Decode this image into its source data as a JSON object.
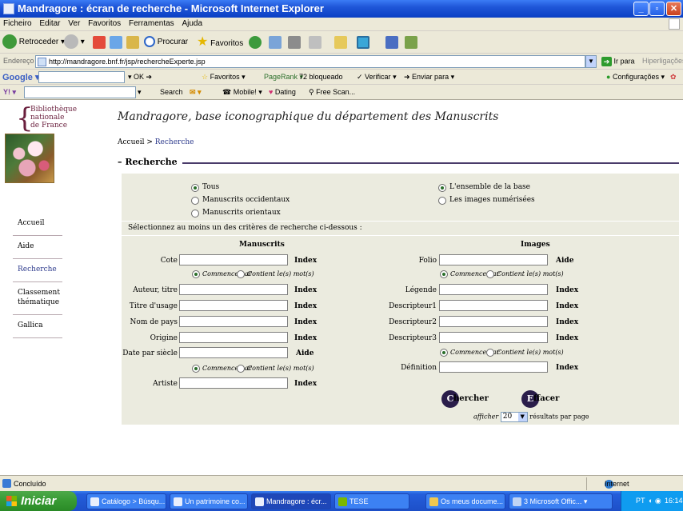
{
  "window": {
    "title": "Mandragore : écran de recherche - Microsoft Internet Explorer"
  },
  "menu": [
    "Ficheiro",
    "Editar",
    "Ver",
    "Favoritos",
    "Ferramentas",
    "Ajuda"
  ],
  "toolbar": {
    "back": "Retroceder",
    "search": "Procurar",
    "favorites": "Favoritos"
  },
  "address": {
    "label": "Endereço",
    "url": "http://mandragore.bnf.fr/jsp/rechercheExperte.jsp",
    "go": "Ir para",
    "links": "Hiperligações"
  },
  "googlebar": {
    "logo": "Google",
    "ok": "OK",
    "favoritos": "Favoritos",
    "pagerank": "PageRank",
    "blocked": "72 bloqueado",
    "verificar": "Verificar",
    "enviar": "Enviar para",
    "config": "Configurações"
  },
  "ybar": {
    "search": "Search",
    "mobile": "Mobile!",
    "dating": "Dating",
    "freescan": "Free Scan..."
  },
  "page": {
    "logo_lines": [
      "Bibliothèque",
      "nationale",
      "de France"
    ],
    "site_title": "Mandragore, base iconographique du département des Manuscrits",
    "crumb_home": "Accueil",
    "crumb_sep": ">",
    "crumb_current": "Recherche",
    "section": "Recherche",
    "nav": [
      "Accueil",
      "Aide",
      "Recherche",
      "Classement thématique",
      "Gallica"
    ],
    "scope": {
      "tous": "Tous",
      "occidentaux": "Manuscrits occidentaux",
      "orientaux": "Manuscrits orientaux",
      "ensemble": "L'ensemble de la base",
      "numerisees": "Les images numérisées"
    },
    "instruction": "Sélectionnez au moins un des critères de recherche ci-dessous :",
    "manuscrits_head": "Manuscrits",
    "images_head": "Images",
    "manuscrits": {
      "cote": "Cote",
      "auteur": "Auteur, titre",
      "titre_usage": "Titre d'usage",
      "nom_pays": "Nom de pays",
      "origine": "Origine",
      "date_siecle": "Date par siècle",
      "artiste": "Artiste"
    },
    "images": {
      "folio": "Folio",
      "legende": "Légende",
      "desc1": "Descripteur1",
      "desc2": "Descripteur2",
      "desc3": "Descripteur3",
      "definition": "Définition"
    },
    "index": "Index",
    "aide": "Aide",
    "commence": "Commence par",
    "contient": "Contient le(s) mot(s)",
    "chercher_initial": "C",
    "chercher_rest": "hercher",
    "effacer_initial": "E",
    "effacer_rest": "ffacer",
    "afficher": "afficher",
    "per_page_value": "20",
    "per_page_suffix": "résultats par page"
  },
  "status": {
    "text": "Concluído",
    "zone": "Internet"
  },
  "taskbar": {
    "start": "Iniciar",
    "tasks": [
      "Catálogo > Búsqu...",
      "Un patrimoine co...",
      "Mandragore : écr...",
      "TESE",
      "Os meus docume...",
      "3 Microsoft Offic..."
    ],
    "tray_lang": "PT",
    "clock": "16:14"
  }
}
